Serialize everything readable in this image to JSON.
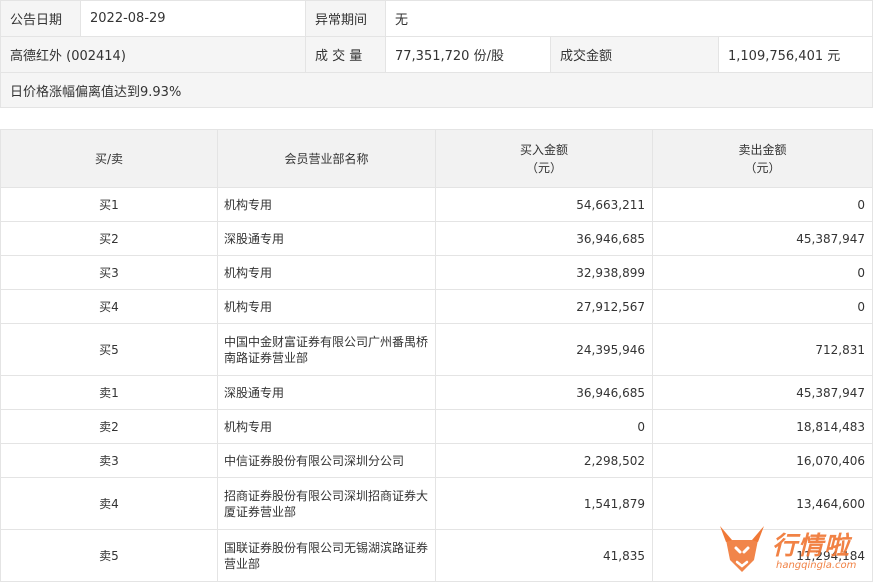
{
  "info": {
    "announce_date_label": "公告日期",
    "announce_date_value": "2022-08-29",
    "abnormal_period_label": "异常期间",
    "abnormal_period_value": "无",
    "stock_name": "高德红外 (002414)",
    "volume_label": "成 交 量",
    "volume_value": "77,351,720 份/股",
    "amount_label": "成交金额",
    "amount_value": "1,109,756,401 元",
    "reason": "日价格涨幅偏离值达到9.93%"
  },
  "table": {
    "headers": {
      "side": "买/卖",
      "dept": "会员营业部名称",
      "buy_line1": "买入金额",
      "buy_line2": "（元）",
      "sell_line1": "卖出金额",
      "sell_line2": "（元）"
    },
    "rows": [
      {
        "side": "买1",
        "dept_line1": "机构专用",
        "dept_line2": "",
        "buy": "54,663,211",
        "sell": "0"
      },
      {
        "side": "买2",
        "dept_line1": "深股通专用",
        "dept_line2": "",
        "buy": "36,946,685",
        "sell": "45,387,947"
      },
      {
        "side": "买3",
        "dept_line1": "机构专用",
        "dept_line2": "",
        "buy": "32,938,899",
        "sell": "0"
      },
      {
        "side": "买4",
        "dept_line1": "机构专用",
        "dept_line2": "",
        "buy": "27,912,567",
        "sell": "0"
      },
      {
        "side": "买5",
        "dept_line1": "中国中金财富证券有限公司广州番禺桥",
        "dept_line2": "南路证券营业部",
        "buy": "24,395,946",
        "sell": "712,831"
      },
      {
        "side": "卖1",
        "dept_line1": "深股通专用",
        "dept_line2": "",
        "buy": "36,946,685",
        "sell": "45,387,947"
      },
      {
        "side": "卖2",
        "dept_line1": "机构专用",
        "dept_line2": "",
        "buy": "0",
        "sell": "18,814,483"
      },
      {
        "side": "卖3",
        "dept_line1": "中信证券股份有限公司深圳分公司",
        "dept_line2": "",
        "buy": "2,298,502",
        "sell": "16,070,406"
      },
      {
        "side": "卖4",
        "dept_line1": "招商证券股份有限公司深圳招商证券大",
        "dept_line2": "厦证券营业部",
        "buy": "1,541,879",
        "sell": "13,464,600"
      },
      {
        "side": "卖5",
        "dept_line1": "国联证券股份有限公司无锡湖滨路证券",
        "dept_line2": "营业部",
        "buy": "41,835",
        "sell": "11,294,184"
      }
    ]
  },
  "watermark": {
    "text": "行情啦",
    "url": "hangqingla.com",
    "color": "#f07836"
  }
}
